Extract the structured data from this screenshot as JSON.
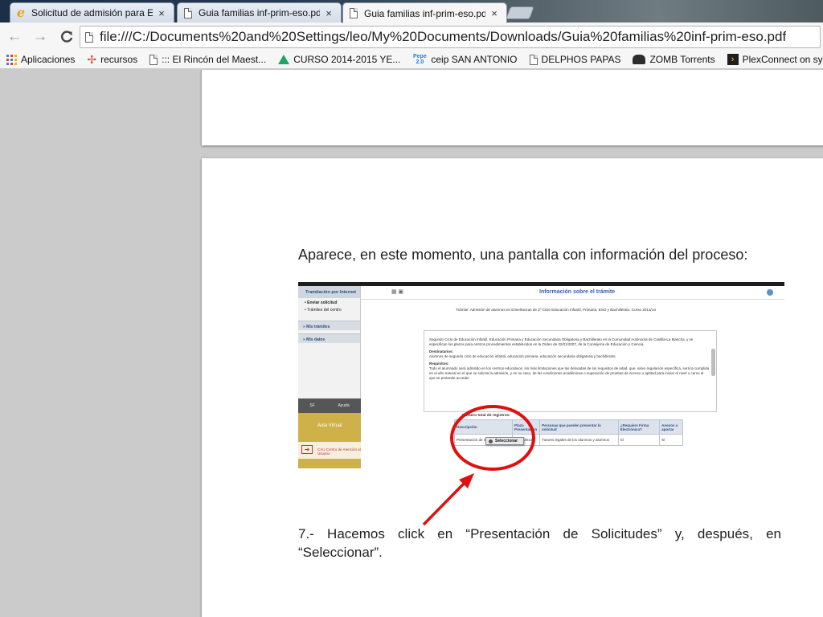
{
  "browser": {
    "tabs": [
      {
        "title": "Solicitud de admisión para Ens",
        "icon": "ie-icon",
        "active": false
      },
      {
        "title": "Guia familias inf-prim-eso.pdf",
        "icon": "document-icon",
        "active": false
      },
      {
        "title": "Guia familias inf-prim-eso.pdf",
        "icon": "document-icon",
        "active": true
      }
    ],
    "close_glyph": "×",
    "nav": {
      "back": "←",
      "forward": "→",
      "reload": "C"
    },
    "url": "file:///C:/Documents%20and%20Settings/leo/My%20Documents/Downloads/Guia%20familias%20inf-prim-eso.pdf",
    "bookmarks": [
      {
        "label": "Aplicaciones",
        "icon": "apps-icon"
      },
      {
        "label": "recursos",
        "icon": "pinwheel-icon"
      },
      {
        "label": "::: El Rincón del Maest...",
        "icon": "document-icon"
      },
      {
        "label": "CURSO 2014-2015 YE...",
        "icon": "drive-icon"
      },
      {
        "label": "ceip SAN ANTONIO",
        "icon": "pepe-icon"
      },
      {
        "label": "DELPHOS PAPAS",
        "icon": "document-icon"
      },
      {
        "label": "ZOMB Torrents",
        "icon": "zomb-icon"
      },
      {
        "label": "PlexConnect on synol...",
        "icon": "plex-icon"
      }
    ]
  },
  "document": {
    "intro": "Aparece, en este momento, una pantalla con información del proceso:",
    "step": "7.- Hacemos click en “Presentación de Solicitudes”  y, después, en “Seleccionar”."
  },
  "screenshot": {
    "sidebar": {
      "header": "Tramitación por Internet",
      "links": [
        "Enviar solicitud",
        "Trámites del centro"
      ],
      "sections": [
        "Mis trámites",
        "Mis datos"
      ],
      "dark_bar": [
        "SF",
        "Ayuda"
      ],
      "aula_virtual": "Aula Virtual",
      "cau": "CAU Centro de Atención al Usuario"
    },
    "title": "Información sobre el trámite",
    "tramite": "Trámite: Admisión de alumnos en Enseñanzas de 2º Ciclo Educación Infantil, Primaria, ESO y Bachillerato. Curso 2013/14",
    "body_intro": "Segundo Ciclo de Educación Infantil, Educación Primaria y Educación Secundaria Obligatoria y Bachillerato en la Comunidad Autónoma de Castilla-La Mancha, y se especifican los plazos para centros procedimientos establecidos en la Orden de 22/01/2007, de la Consejería de Educación y Ciencia.",
    "dest_label": "Destinatarios:",
    "dest_text": "Alumnos de segundo ciclo de educación infantil, educación primaria, educación secundaria obligatoria y bachillerato.",
    "req_label": "Requisitos:",
    "req_text": "Todo el alumnado será admitido en los centros educativos, sin más limitaciones que las derivadas de los requisitos de edad, que, salvo regulación específica, será la cumplida en el año natural en el que se solicita la admisión, y en su caso, de las condiciones académicas o superación de pruebas de acceso o aptitud para iniciar el nivel o curso al que se pretende acceder.",
    "table_label": "Número total de registros:",
    "table_headers": [
      "Descripción",
      "Plazo Presentación",
      "Personas que pueden presentar la solicitud",
      "¿Requiere Firma Electrónica?",
      "Anexos a aportar"
    ],
    "table_row": [
      "Presentación de Solicitudes",
      "20/11/2013",
      "Tutores legales de los alumnos y alumnos",
      "Sí",
      "Sí"
    ],
    "popup": "Seleccionar"
  },
  "colors": {
    "annotation": "#e01010",
    "screenshot_title": "#3662a3"
  }
}
